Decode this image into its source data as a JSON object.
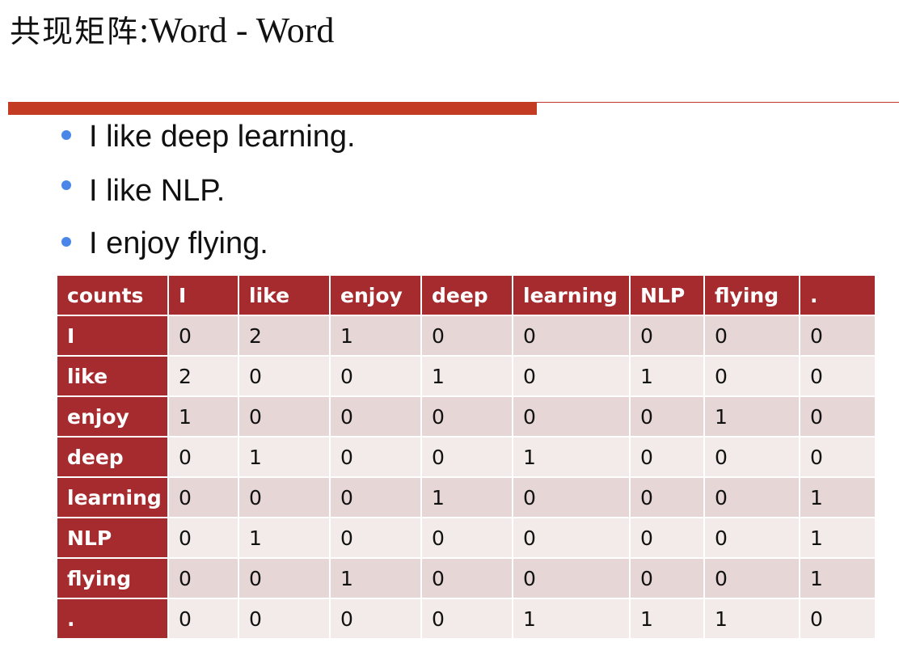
{
  "title": {
    "zh": "共现矩阵",
    "en": ":Word - Word"
  },
  "bullets": [
    "I like deep learning.",
    "I like NLP.",
    "I enjoy flying."
  ],
  "colors": {
    "accent": "#c23b22",
    "table_header": "#a62b2e",
    "row_odd": "#e6d6d5",
    "row_even": "#f2ebea",
    "bullet": "#4a86e8"
  },
  "table": {
    "corner": "counts",
    "columns": [
      "I",
      "like",
      "enjoy",
      "deep",
      "learning",
      "NLP",
      "flying",
      "."
    ],
    "rows": [
      {
        "label": "I",
        "cells": [
          "0",
          "2",
          "1",
          "0",
          "0",
          "0",
          "0",
          "0"
        ]
      },
      {
        "label": "like",
        "cells": [
          "2",
          "0",
          "0",
          "1",
          "0",
          "1",
          "0",
          "0"
        ]
      },
      {
        "label": "enjoy",
        "cells": [
          "1",
          "0",
          "0",
          "0",
          "0",
          "0",
          "1",
          "0"
        ]
      },
      {
        "label": "deep",
        "cells": [
          "0",
          "1",
          "0",
          "0",
          "1",
          "0",
          "0",
          "0"
        ]
      },
      {
        "label": "learning",
        "cells": [
          "0",
          "0",
          "0",
          "1",
          "0",
          "0",
          "0",
          "1"
        ]
      },
      {
        "label": "NLP",
        "cells": [
          "0",
          "1",
          "0",
          "0",
          "0",
          "0",
          "0",
          "1"
        ]
      },
      {
        "label": "flying",
        "cells": [
          "0",
          "0",
          "1",
          "0",
          "0",
          "0",
          "0",
          "1"
        ]
      },
      {
        "label": ".",
        "cells": [
          "0",
          "0",
          "0",
          "0",
          "1",
          "1",
          "1",
          "0"
        ]
      }
    ]
  }
}
